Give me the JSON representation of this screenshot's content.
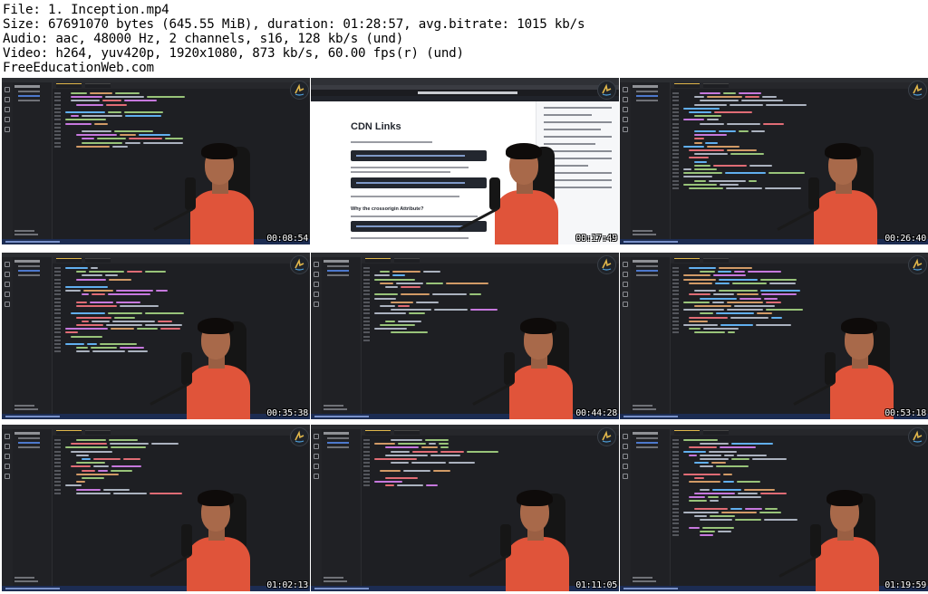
{
  "header": {
    "file": "File: 1. Inception.mp4",
    "size": "Size: 67691070 bytes (645.55 MiB), duration: 01:28:57, avg.bitrate: 1015 kb/s",
    "audio": "Audio: aac, 48000 Hz, 2 channels, s16, 128 kb/s (und)",
    "video": "Video: h264, yuv420p, 1920x1080, 873 kb/s, 60.00 fps(r) (und)",
    "site": "FreeEducationWeb.com"
  },
  "browser": {
    "heading": "CDN Links",
    "subheading": "Why the crossorigin Attribute?"
  },
  "thumbnails": [
    {
      "timestamp": "00:08:54",
      "kind": "editor"
    },
    {
      "timestamp": "00:17:49",
      "kind": "browser"
    },
    {
      "timestamp": "00:26:40",
      "kind": "editor"
    },
    {
      "timestamp": "00:35:38",
      "kind": "editor"
    },
    {
      "timestamp": "00:44:28",
      "kind": "editor"
    },
    {
      "timestamp": "00:53:18",
      "kind": "editor"
    },
    {
      "timestamp": "01:02:13",
      "kind": "editor"
    },
    {
      "timestamp": "01:11:05",
      "kind": "editor"
    },
    {
      "timestamp": "01:19:59",
      "kind": "editor"
    }
  ],
  "colors": {
    "editor_bg": "#1e1f23",
    "shirt": "#e0543a",
    "status_bar": "#1c2c52",
    "keyword": "#c678dd",
    "string": "#98c379",
    "tag": "#e06c75",
    "attr": "#d19a66",
    "func": "#61afef",
    "plain": "#abb2bf"
  },
  "icons": [
    "code-editor-logo-icon"
  ]
}
